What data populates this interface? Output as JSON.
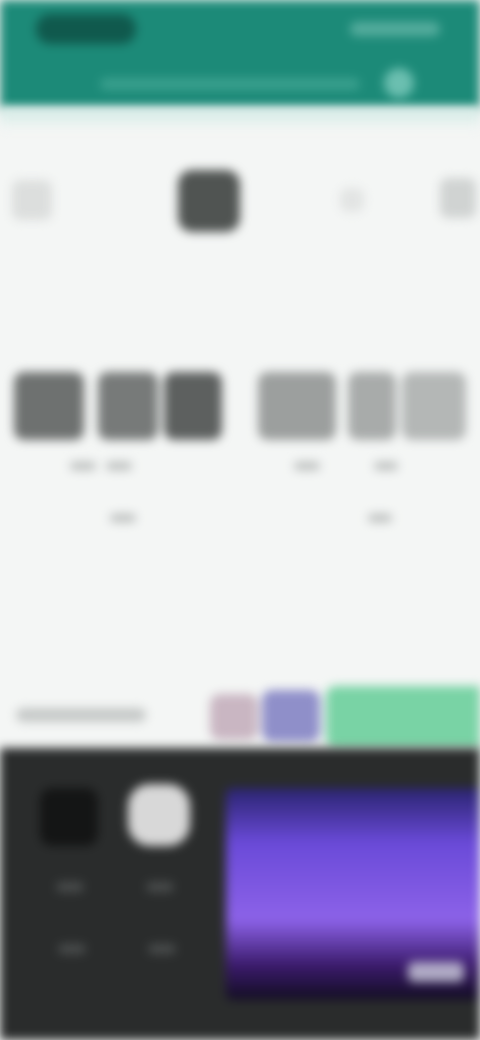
{
  "colors": {
    "app_bar": "#1c8a78",
    "background": "#f4f6f5",
    "media_panel": "#2a2c2c",
    "accent_green": "#79d3a5",
    "video_purple": "#8c62e8"
  },
  "app_bar": {
    "action_icon": "settings-icon"
  },
  "picker": {
    "icons": [
      "back-icon",
      "clock-icon",
      "separator-icon",
      "forward-icon"
    ]
  },
  "digit_tiles": [
    {
      "shade": "#6e7170"
    },
    {
      "shade": "#777a79"
    },
    {
      "shade": "#5d605f"
    },
    {
      "shade": "#9c9f9e"
    },
    {
      "shade": "#a8abaa"
    },
    {
      "shade": "#b4b7b6"
    }
  ],
  "media": {
    "controls": [
      "stop-icon",
      "play-icon",
      "rewind-icon",
      "forward-icon",
      "volume-icon",
      "fullscreen-icon"
    ]
  }
}
